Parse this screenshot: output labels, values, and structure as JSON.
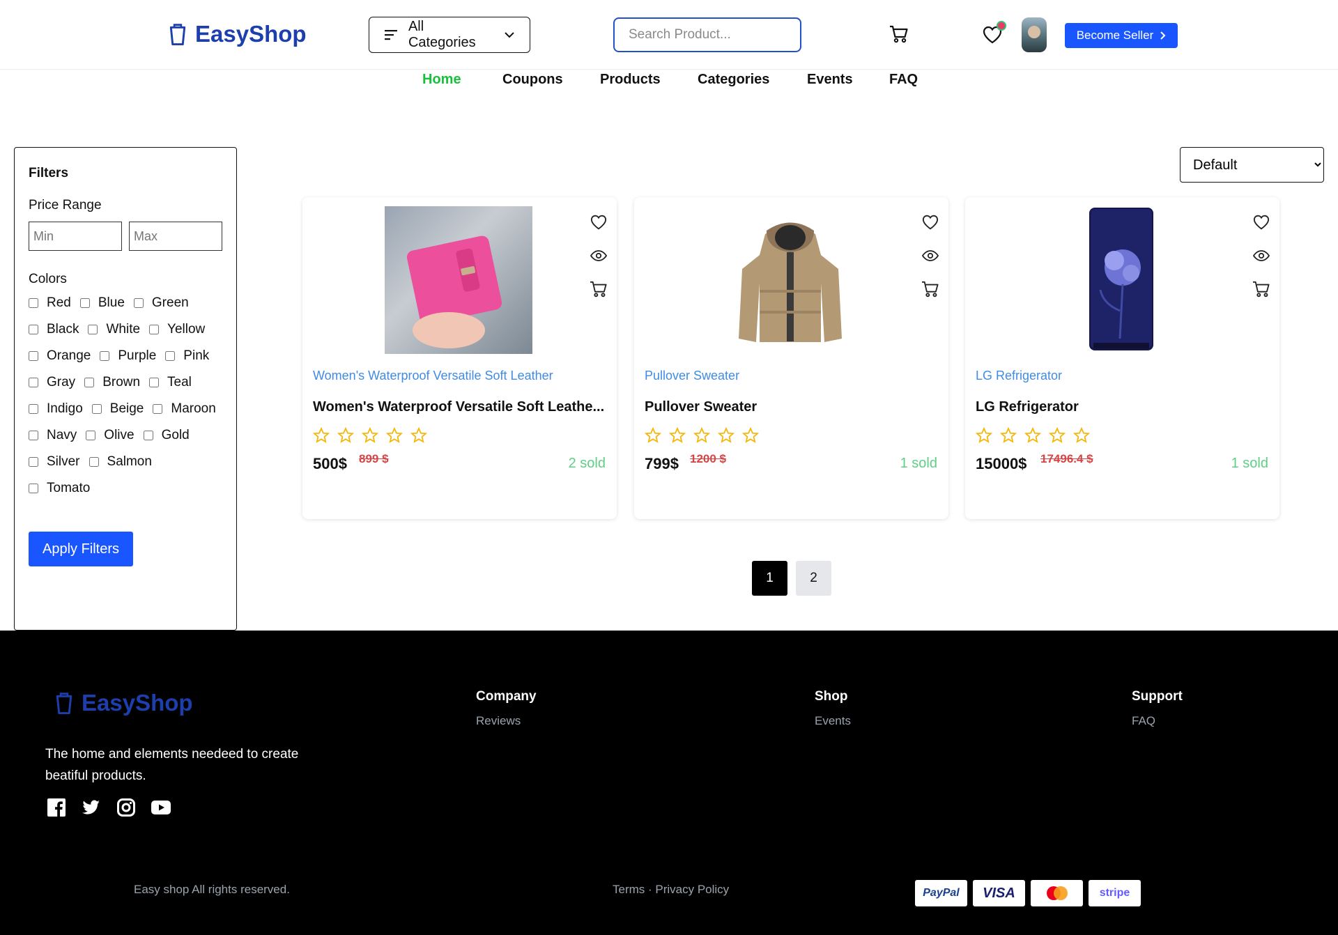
{
  "header": {
    "logo_text": "EasyShop",
    "categories_label": "All Categories",
    "search_placeholder": "Search Product...",
    "seller_label": "Become Seller"
  },
  "nav": [
    "Home",
    "Coupons",
    "Products",
    "Categories",
    "Events",
    "FAQ"
  ],
  "filters": {
    "title": "Filters",
    "price_label": "Price Range",
    "min_placeholder": "Min",
    "max_placeholder": "Max",
    "colors_label": "Colors",
    "colors": [
      "Red",
      "Blue",
      "Green",
      "Black",
      "White",
      "Yellow",
      "Orange",
      "Purple",
      "Pink",
      "Gray",
      "Brown",
      "Teal",
      "Indigo",
      "Beige",
      "Maroon",
      "Navy",
      "Olive",
      "Gold",
      "Silver",
      "Salmon",
      "Tomato"
    ],
    "apply_label": "Apply Filters"
  },
  "sort": {
    "selected": "Default"
  },
  "products": [
    {
      "shop": "Women's Waterproof Versatile Soft Leather",
      "name": "Women's Waterproof Versatile Soft Leathe...",
      "price": "500$",
      "old_price": "899 $",
      "sold": "2 sold",
      "rating": 0
    },
    {
      "shop": "Pullover Sweater",
      "name": "Pullover Sweater",
      "price": "799$",
      "old_price": "1200 $",
      "sold": "1 sold",
      "rating": 0
    },
    {
      "shop": "LG Refrigerator",
      "name": "LG Refrigerator",
      "price": "15000$",
      "old_price": "17496.4 $",
      "sold": "1 sold",
      "rating": 0
    }
  ],
  "pagination": [
    "1",
    "2"
  ],
  "footer": {
    "logo_text": "EasyShop",
    "tagline": "The home and elements needeed to create beatiful products.",
    "company_title": "Company",
    "company_link": "Reviews",
    "shop_title": "Shop",
    "shop_link": "Events",
    "support_title": "Support",
    "support_link": "FAQ",
    "copyright": "Easy shop All rights reserved.",
    "legal": "Terms · Privacy Policy",
    "payments": [
      "PayPal",
      "VISA",
      "mastercard",
      "stripe"
    ]
  },
  "colors": {
    "accent": "#1a56ff",
    "brand": "#1d3fae",
    "nav_active": "#19c13a",
    "shop_link": "#3f8be6",
    "sold": "#5ecf86",
    "old_price": "#d64545",
    "star": "#f5b70a"
  }
}
